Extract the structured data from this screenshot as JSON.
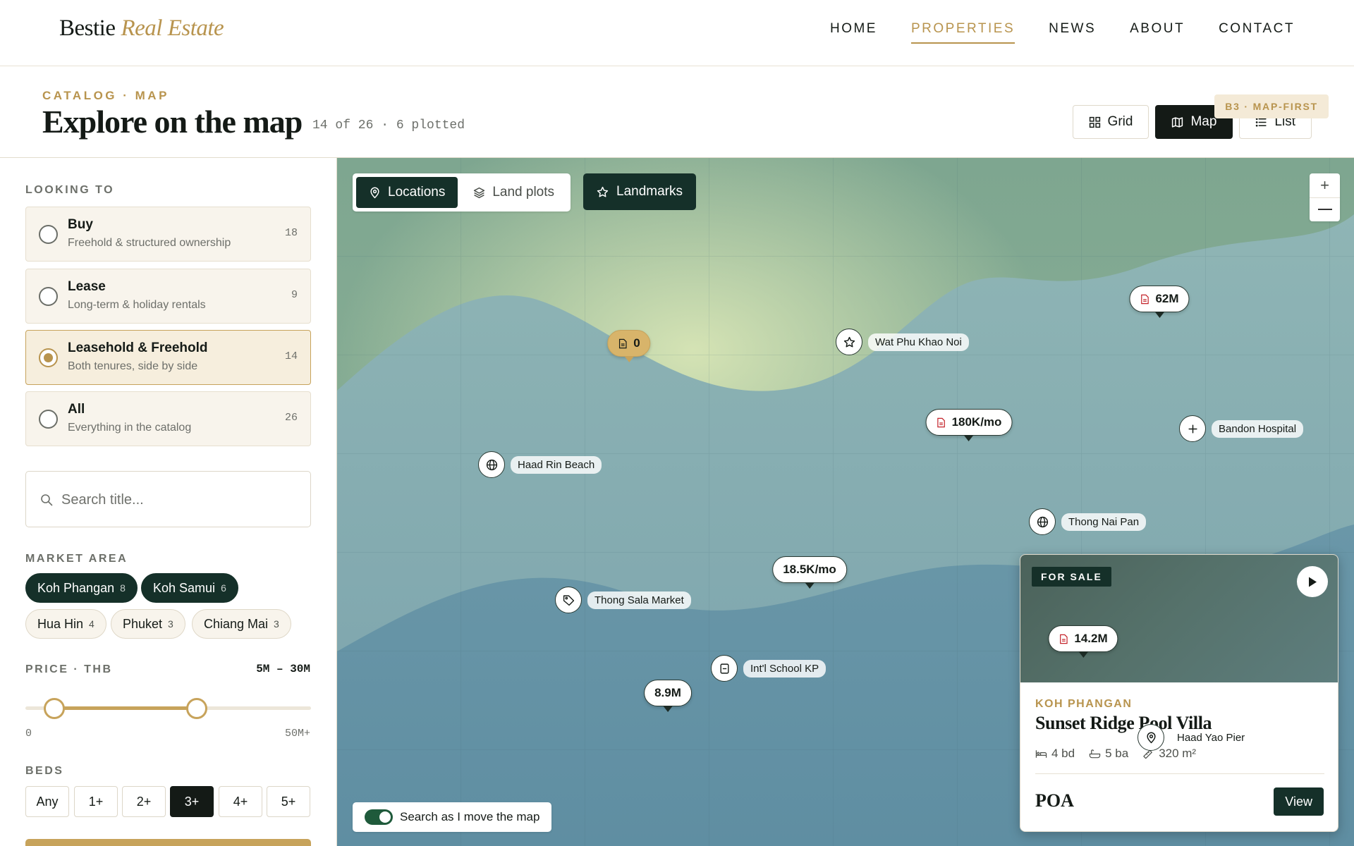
{
  "header": {
    "brand": "Bestie",
    "brand_sub": "Real Estate",
    "nav": [
      {
        "label": "HOME",
        "active": false
      },
      {
        "label": "PROPERTIES",
        "active": true
      },
      {
        "label": "NEWS",
        "active": false
      },
      {
        "label": "ABOUT",
        "active": false
      },
      {
        "label": "CONTACT",
        "active": false
      }
    ]
  },
  "page": {
    "eyebrow": "CATALOG · MAP",
    "title": "Explore on the map",
    "count": "14 of 26 · 6 plotted",
    "version_tag": "B3 · MAP-FIRST",
    "views": [
      {
        "label": "Grid",
        "icon": "grid-icon",
        "active": false
      },
      {
        "label": "Map",
        "icon": "map-icon",
        "active": true
      },
      {
        "label": "List",
        "icon": "list-icon",
        "active": false
      }
    ]
  },
  "sidebar": {
    "looking_label": "LOOKING TO",
    "options": [
      {
        "title": "Buy",
        "desc": "Freehold & structured ownership",
        "count": "18",
        "selected": false
      },
      {
        "title": "Lease",
        "desc": "Long-term & holiday rentals",
        "count": "9",
        "selected": false
      },
      {
        "title": "Leasehold & Freehold",
        "desc": "Both tenures, side by side",
        "count": "14",
        "selected": true
      },
      {
        "title": "All",
        "desc": "Everything in the catalog",
        "count": "26",
        "selected": false
      }
    ],
    "search": {
      "placeholder": "Search title...",
      "value": ""
    },
    "market_label": "MARKET AREA",
    "markets": [
      {
        "label": "Koh Phangan",
        "count": "8",
        "active": true
      },
      {
        "label": "Koh Samui",
        "count": "6",
        "active": true
      },
      {
        "label": "Hua Hin",
        "count": "4",
        "active": false
      },
      {
        "label": "Phuket",
        "count": "3",
        "active": false
      },
      {
        "label": "Chiang Mai",
        "count": "3",
        "active": false
      }
    ],
    "price": {
      "label": "PRICE · THB",
      "range_text": "5M – 30M",
      "min_label": "0",
      "max_label": "50M+",
      "low_fraction": 0.1,
      "high_fraction": 0.6
    },
    "beds_label": "BEDS",
    "beds": [
      {
        "label": "Any",
        "active": false
      },
      {
        "label": "1+",
        "active": false
      },
      {
        "label": "2+",
        "active": false
      },
      {
        "label": "3+",
        "active": true
      },
      {
        "label": "4+",
        "active": false
      },
      {
        "label": "5+",
        "active": false
      }
    ]
  },
  "map": {
    "layers": [
      {
        "label": "Locations",
        "icon": "pin-icon",
        "active": true
      },
      {
        "label": "Land plots",
        "icon": "layers-icon",
        "active": false
      }
    ],
    "landmarks_button": "Landmarks",
    "zoom_in": "+",
    "price_pins": [
      {
        "label": "0",
        "doc": true,
        "gold": true
      },
      {
        "label": "62M",
        "doc": true,
        "gold": false
      },
      {
        "label": "180K/mo",
        "doc": true,
        "gold": false
      },
      {
        "label": "18.5K/mo",
        "doc": false,
        "gold": false
      },
      {
        "label": "8.9M",
        "doc": false,
        "gold": false
      },
      {
        "label": "14.2M",
        "doc": true,
        "gold": false
      }
    ],
    "landmarks": [
      {
        "label": "Wat Phu Khao Noi",
        "icon": "star-icon"
      },
      {
        "label": "Bandon Hospital",
        "icon": "plus-icon"
      },
      {
        "label": "Haad Rin Beach",
        "icon": "globe-icon"
      },
      {
        "label": "Thong Nai Pan",
        "icon": "globe-icon"
      },
      {
        "label": "Thong Sala Market",
        "icon": "tag-icon"
      },
      {
        "label": "Int'l School KP",
        "icon": "school-icon"
      },
      {
        "label": "Haad Yao Pier",
        "icon": "pin-icon"
      }
    ],
    "search_move_label": "Search as I move the map",
    "search_move_on": true
  },
  "card": {
    "badge": "FOR SALE",
    "area": "KOH PHANGAN",
    "title": "Sunset Ridge Pool Villa",
    "beds": "4 bd",
    "baths": "5 ba",
    "size": "320 m²",
    "price": "POA",
    "cta": "View"
  },
  "colors": {
    "accent_gold": "#b8944e",
    "dark_green": "#153029",
    "ink": "#141a16"
  }
}
